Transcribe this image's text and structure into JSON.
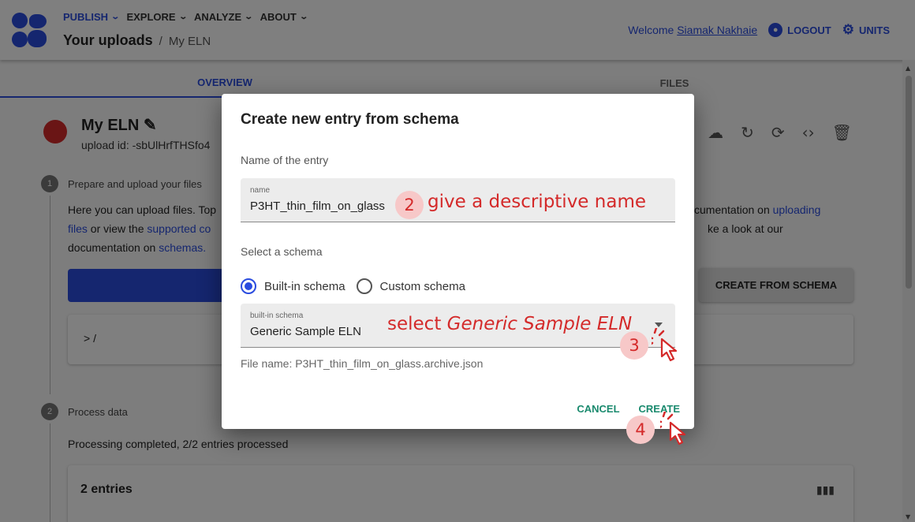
{
  "appbar": {
    "menu": [
      {
        "label": "PUBLISH",
        "active": true
      },
      {
        "label": "EXPLORE",
        "active": false
      },
      {
        "label": "ANALYZE",
        "active": false
      },
      {
        "label": "ABOUT",
        "active": false
      }
    ],
    "breadcrumb_main": "Your uploads",
    "breadcrumb_sep": "/",
    "breadcrumb_sub": "My ELN",
    "welcome_prefix": "Welcome",
    "user_name": "Siamak Nakhaie",
    "logout_label": "LOGOUT",
    "units_label": "UNITS"
  },
  "tabs": [
    "OVERVIEW",
    "FILES"
  ],
  "upload": {
    "title": "My ELN",
    "id_text": "upload id: -sbUlHrfTHSfo4"
  },
  "steps": {
    "step1_num": "1",
    "step1_label": "Prepare and upload your files",
    "step1_line1_a": "Here you can upload files. Top",
    "step1_line1_b": "cumentation on",
    "step1_line1_link": "uploading",
    "step1_line2_link_a": "files",
    "step1_line2_a": "or view the",
    "step1_line2_link_b": "supported co",
    "step1_line2_b": "ke a look at our",
    "step1_line3_a": "documentation on",
    "step1_line3_link": "schemas.",
    "create_from_schema": "CREATE FROM SCHEMA",
    "path_text": ">  /",
    "step2_num": "2",
    "step2_label": "Process data",
    "processing_text": "Processing completed, 2/2 entries processed",
    "entries_title": "2 entries"
  },
  "dialog": {
    "title": "Create new entry from schema",
    "name_section": "Name of the entry",
    "name_field_label": "name",
    "name_field_value": "P3HT_thin_film_on_glass",
    "schema_section": "Select a schema",
    "radio_builtin": "Built-in schema",
    "radio_custom": "Custom schema",
    "builtin_selected": true,
    "schema_field_label": "built-in schema",
    "schema_field_value": "Generic Sample ELN",
    "file_name": "File name: P3HT_thin_film_on_glass.archive.json",
    "cancel_label": "CANCEL",
    "create_label": "CREATE"
  },
  "annotations": {
    "badge2": "2",
    "text2": "give a descriptive name",
    "text3_prefix": "select",
    "text3_emph": "Generic Sample ELN",
    "badge3": "3",
    "badge4": "4"
  },
  "colors": {
    "primary": "#2a4cdf",
    "action_green": "#1a8a6e",
    "annotation_red": "#d42a2a"
  }
}
